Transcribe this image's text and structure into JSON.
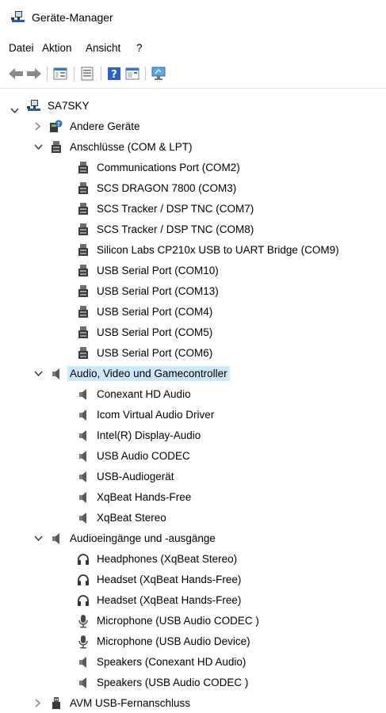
{
  "window": {
    "title": "Geräte-Manager"
  },
  "menu": {
    "items": [
      "Datei",
      "Aktion",
      "Ansicht",
      "?"
    ]
  },
  "tree": {
    "root": "SA7SKY",
    "andere": "Andere Geräte",
    "ports": {
      "label": "Anschlüsse (COM & LPT)",
      "items": [
        "Communications Port (COM2)",
        "SCS DRAGON 7800 (COM3)",
        "SCS Tracker / DSP TNC (COM7)",
        "SCS Tracker / DSP TNC (COM8)",
        "Silicon Labs CP210x USB to UART Bridge (COM9)",
        "USB Serial Port (COM10)",
        "USB Serial Port (COM13)",
        "USB Serial Port (COM4)",
        "USB Serial Port (COM5)",
        "USB Serial Port (COM6)"
      ]
    },
    "audio": {
      "label": "Audio, Video und Gamecontroller",
      "items": [
        "Conexant HD Audio",
        "Icom Virtual Audio Driver",
        "Intel(R) Display-Audio",
        "USB Audio CODEC",
        "USB-Audiogerät",
        "XqBeat Hands-Free",
        "XqBeat Stereo"
      ]
    },
    "audioio": {
      "label": "Audioeingänge und -ausgänge",
      "items": [
        "Headphones (XqBeat Stereo)",
        "Headset (XqBeat Hands-Free)",
        "Headset (XqBeat Hands-Free)",
        "Microphone (USB Audio CODEC )",
        "Microphone (USB Audio Device)",
        "Speakers (Conexant HD Audio)",
        "Speakers (USB Audio CODEC )"
      ]
    },
    "avm": "AVM USB-Fernanschluss"
  },
  "colors": {
    "selection": "#cce8ff",
    "accent": "#0a68b7"
  }
}
